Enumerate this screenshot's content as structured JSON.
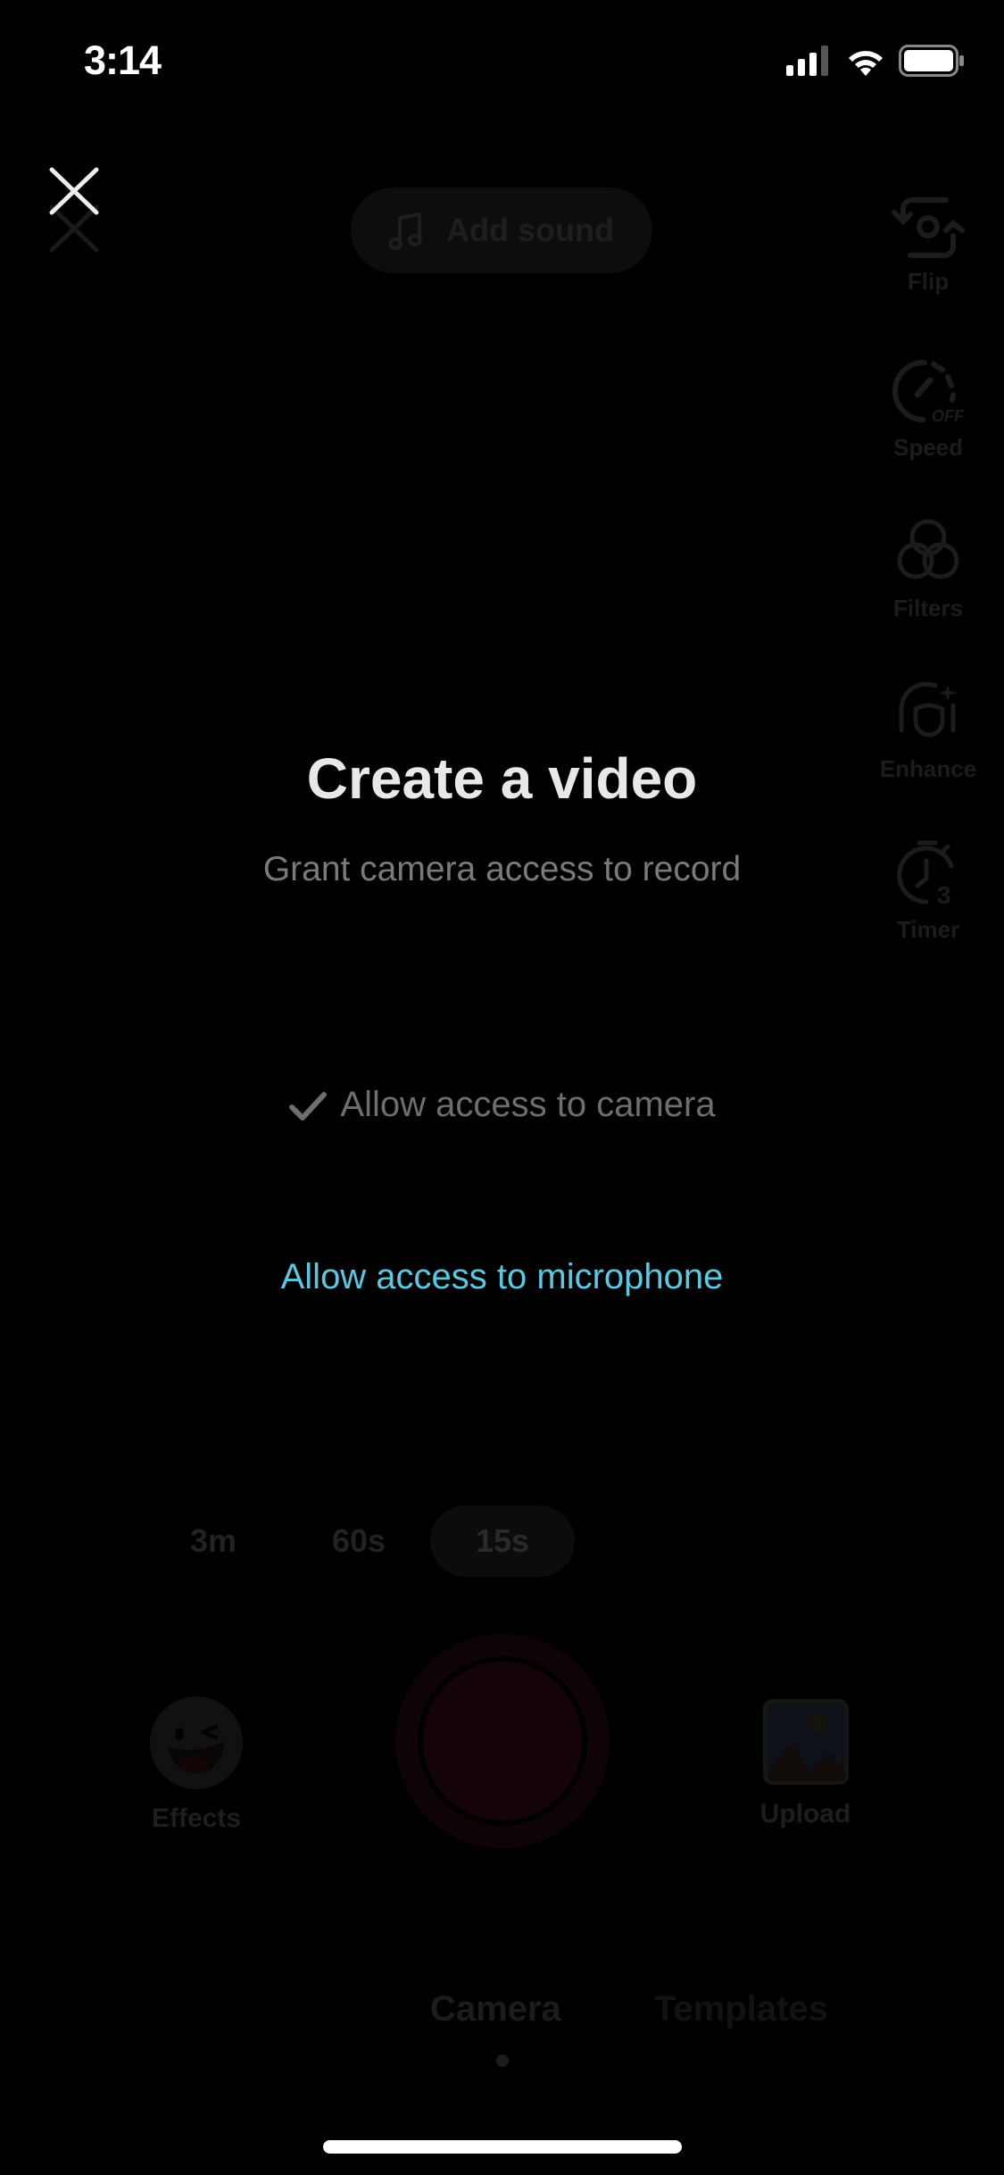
{
  "status_bar": {
    "time": "3:14",
    "icons": [
      "cellular-signal-icon",
      "wifi-icon",
      "battery-icon"
    ]
  },
  "top_bar": {
    "close_icon": "close-icon",
    "add_sound_label": "Add sound",
    "add_sound_icon": "music-note-icon"
  },
  "side_tools": [
    {
      "label": "Flip",
      "icon": "flip-camera-icon"
    },
    {
      "label": "Speed",
      "icon": "speed-icon",
      "badge": "OFF"
    },
    {
      "label": "Filters",
      "icon": "filters-icon"
    },
    {
      "label": "Enhance",
      "icon": "enhance-icon"
    },
    {
      "label": "Timer",
      "icon": "timer-icon",
      "badge": "3"
    }
  ],
  "permission_prompt": {
    "title": "Create a video",
    "subtitle": "Grant camera access to record",
    "camera_permission": {
      "label": "Allow access to camera",
      "granted": true
    },
    "microphone_permission": {
      "label": "Allow access to microphone",
      "granted": false
    }
  },
  "durations": {
    "options": [
      "3m",
      "60s",
      "15s"
    ],
    "selected": "15s"
  },
  "bottom_controls": {
    "effects_label": "Effects",
    "upload_label": "Upload",
    "record_color": "#fe2c55"
  },
  "mode_tabs": {
    "items": [
      "Camera",
      "Templates"
    ],
    "selected": "Camera"
  },
  "colors": {
    "background": "#000000",
    "link": "#5ac8e0",
    "title": "#e8e8e8"
  }
}
